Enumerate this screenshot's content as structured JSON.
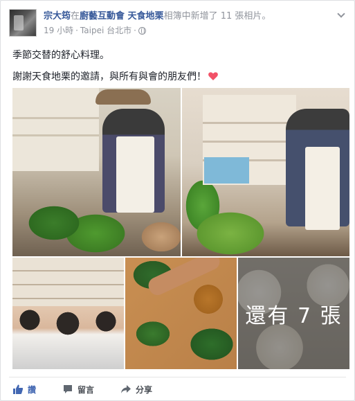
{
  "post": {
    "author": "宗大筠",
    "connector": "在",
    "place": "廚藝互動會 天食地栗",
    "action_text": "相簿中新增了 11 張相片。",
    "time": "19 小時",
    "separator1": " · ",
    "location": "Taipei 台北市",
    "separator2": " · ",
    "line1": "季節交替的舒心料理。",
    "line2": "謝謝天食地栗的邀請，與所有與會的朋友們！"
  },
  "photos": {
    "more_label": "還有 7 張"
  },
  "actions": {
    "like_label": "讚",
    "comment_label": "留言",
    "share_label": "分享"
  },
  "colors": {
    "link": "#365899",
    "like_blue": "#4267b2",
    "heart": "#f25268",
    "meta_gray": "#90949c"
  },
  "icons": [
    "globe-icon",
    "chevron-down-icon",
    "heart-icon",
    "like-icon",
    "comment-icon",
    "share-icon"
  ]
}
